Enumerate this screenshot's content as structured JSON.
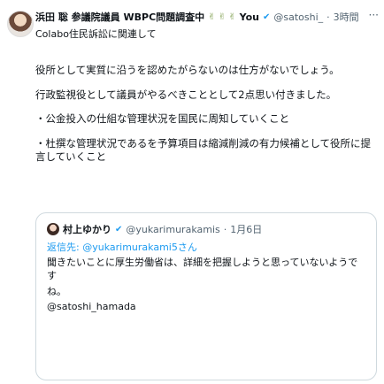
{
  "tweet": {
    "author_name": "浜田 聡 参議院議員 WBPC問題調査中",
    "emoji": "✌ ✌ ✌",
    "author_suffix": "You",
    "handle": "@satoshi_",
    "time": "3時間",
    "more": "···",
    "reply_context": "Colabo住民訴訟に関連して",
    "paragraphs": [
      "役所として実質に沿うを認めたがらないのは仕方がないでしょう。",
      "行政監視役として議員がやるべきこととして2点思い付きました。",
      "・公金投入の仕組な管理状況を国民に周知していくこと",
      "・杜撰な管理状況であるを予算項目は縮減削減の有力候補として役所に提言していくこと"
    ]
  },
  "quote": {
    "author_name": "村上ゆかり",
    "handle": "@yukarimurakamis",
    "time": "1月6日",
    "reply_to_prefix": "返信先:",
    "reply_to_handle": "@yukarimurakami5さん",
    "lines": [
      "聞きたいことに厚生労働省は、詳細を把握しようと思っていないようです",
      "ね。",
      "@satoshi_hamada"
    ]
  },
  "colors": {
    "accent": "#1d9bf0",
    "muted": "#536471",
    "border": "#cfd9de"
  }
}
